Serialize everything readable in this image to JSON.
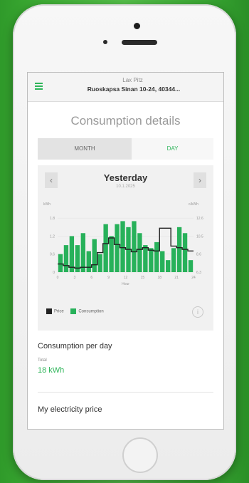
{
  "header": {
    "title": "Lax Pitz",
    "subtitle": "Ruoskapsa Sinan 10-24, 40344..."
  },
  "page": {
    "title": "Consumption details"
  },
  "tabs": {
    "month": "MONTH",
    "day": "DAY",
    "active": "day"
  },
  "day_nav": {
    "title": "Yesterday",
    "date": "10.1.2025",
    "prev": "‹",
    "next": "›"
  },
  "chart_data": {
    "type": "bar",
    "x": [
      0,
      1,
      2,
      3,
      4,
      5,
      6,
      7,
      8,
      9,
      10,
      11,
      12,
      13,
      14,
      15,
      16,
      17,
      18,
      19,
      20,
      21,
      22,
      23
    ],
    "xtick_labels": [
      "0",
      "3",
      "6",
      "9",
      "12",
      "15",
      "18",
      "21",
      "24"
    ],
    "xlabel": "Hour",
    "left_axis_label": "kWh",
    "right_axis_label": "c/kWh",
    "left_ticks": [
      "0",
      "0.6",
      "1.2",
      "1.8"
    ],
    "right_ticks": [
      "6.3",
      "8.6",
      "10.5",
      "12.6"
    ],
    "series": [
      {
        "name": "Consumption",
        "values": [
          0.6,
          0.9,
          1.2,
          0.9,
          1.3,
          0.7,
          1.1,
          0.6,
          1.6,
          1.2,
          1.6,
          1.7,
          1.5,
          1.7,
          1.3,
          0.9,
          0.8,
          1.0,
          0.7,
          0.4,
          0.8,
          1.5,
          1.3,
          0.4
        ]
      },
      {
        "name": "Price",
        "values": [
          7.0,
          6.8,
          6.6,
          6.5,
          6.6,
          6.6,
          6.9,
          8.4,
          9.5,
          10.2,
          9.4,
          9.0,
          8.8,
          8.5,
          8.8,
          9.0,
          8.7,
          8.6,
          11.4,
          11.4,
          9.2,
          9.0,
          8.8,
          8.6
        ]
      }
    ],
    "colors": {
      "consumption": "#27b15a",
      "price": "#222222"
    }
  },
  "legend": {
    "price": "Price",
    "consumption": "Consumption"
  },
  "info_icon": "i",
  "consumption_per_day": {
    "title": "Consumption per day",
    "total_label": "Total",
    "total_value": "18 kWh"
  },
  "electricity_price": {
    "title": "My electricity price"
  }
}
